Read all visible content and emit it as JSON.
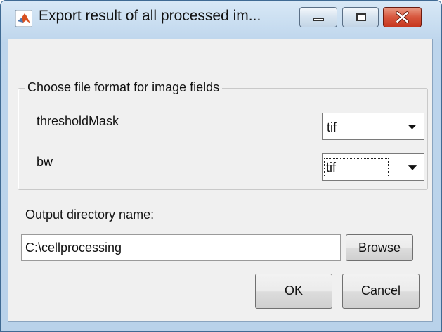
{
  "window": {
    "title": "Export result of all processed im...",
    "icon": "matlab-icon",
    "controls": [
      "minimize-icon",
      "maximize-icon",
      "close-icon"
    ]
  },
  "group": {
    "legend": "Choose file format for image fields",
    "fields": [
      {
        "label": "thresholdMask",
        "value": "tif"
      },
      {
        "label": "bw",
        "value": "tif"
      }
    ]
  },
  "output": {
    "label": "Output directory name:",
    "value": "C:\\cellprocessing",
    "browse_label": "Browse"
  },
  "buttons": {
    "ok": "OK",
    "cancel": "Cancel"
  }
}
